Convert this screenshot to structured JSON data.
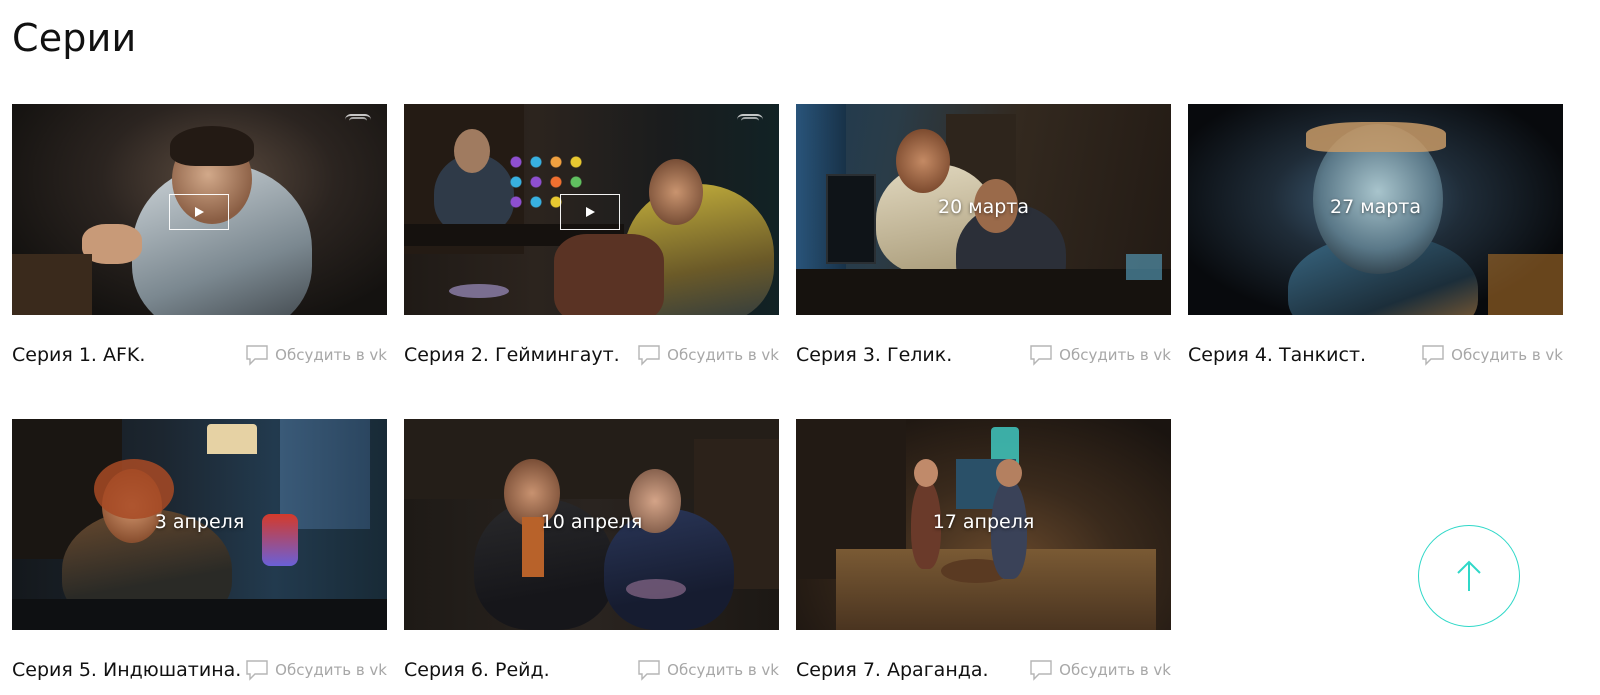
{
  "section": {
    "title": "Серии"
  },
  "episodes": [
    {
      "title": "Серия 1. AFK.",
      "discuss_label": "Обсудить в vk",
      "date": "",
      "has_play": true,
      "has_logo": true
    },
    {
      "title": "Серия 2. Геймингаут.",
      "discuss_label": "Обсудить в vk",
      "date": "",
      "has_play": true,
      "has_logo": true
    },
    {
      "title": "Серия 3. Гелик.",
      "discuss_label": "Обсудить в vk",
      "date": "20 марта",
      "has_play": false,
      "has_logo": false
    },
    {
      "title": "Серия 4. Танкист.",
      "discuss_label": "Обсудить в vk",
      "date": "27 марта",
      "has_play": false,
      "has_logo": false
    },
    {
      "title": "Серия 5. Индюшатина.",
      "discuss_label": "Обсудить в vk",
      "date": "3 апреля",
      "has_play": false,
      "has_logo": false
    },
    {
      "title": "Серия 6. Рейд.",
      "discuss_label": "Обсудить в vk",
      "date": "10 апреля",
      "has_play": false,
      "has_logo": false
    },
    {
      "title": "Серия 7. Араганда.",
      "discuss_label": "Обсудить в vk",
      "date": "17 апреля",
      "has_play": false,
      "has_logo": false
    }
  ],
  "icons": {
    "play": "play-icon",
    "comment": "comment-bubble-icon",
    "scroll_top": "arrow-up-icon"
  },
  "colors": {
    "accent": "#2fd8c8",
    "muted_text": "#a7a7a7",
    "title_text": "#111111"
  }
}
